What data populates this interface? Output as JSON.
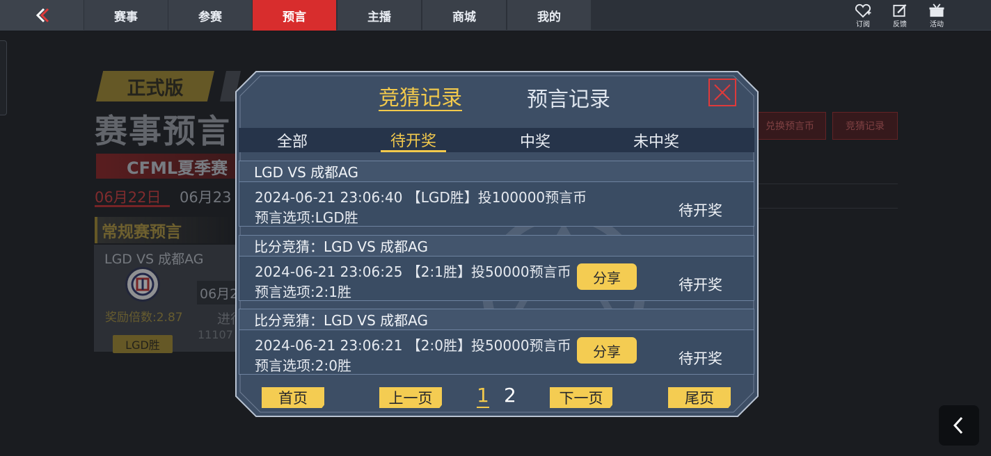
{
  "nav": {
    "tabs": [
      {
        "label": "赛事"
      },
      {
        "label": "参赛"
      },
      {
        "label": "预言"
      },
      {
        "label": "主播"
      },
      {
        "label": "商城"
      },
      {
        "label": "我的"
      }
    ],
    "active_index": 2,
    "icons": [
      {
        "name": "subscribe-icon",
        "label": "订阅"
      },
      {
        "name": "feedback-icon",
        "label": "反馈"
      },
      {
        "name": "event-icon",
        "label": "活动"
      }
    ]
  },
  "background": {
    "version_badge": "正式版",
    "title": "赛事预言",
    "season": "CFML夏季赛",
    "date_active": "06月22日",
    "date_next": "06月23",
    "section_title": "常规赛预言",
    "card_title": "LGD VS 成都AG",
    "card_odds": "奖励倍数:2.87",
    "card_pick": "LGD胜",
    "card_date": "06月2",
    "card_status": "进行",
    "card_number": "11107",
    "exchange_button": "兑换预言币",
    "records_button": "竞猜记录"
  },
  "modal": {
    "tabs": [
      {
        "label": "竞猜记录"
      },
      {
        "label": "预言记录"
      }
    ],
    "active_tab": 0,
    "filters": [
      {
        "label": "全部"
      },
      {
        "label": "待开奖"
      },
      {
        "label": "中奖"
      },
      {
        "label": "未中奖"
      }
    ],
    "active_filter": 1,
    "records": [
      {
        "title": "LGD VS 成都AG",
        "line1": "2024-06-21 23:06:40 【LGD胜】投100000预言币",
        "line2": "预言选项:LGD胜",
        "status": "待开奖",
        "share": null
      },
      {
        "title": "比分竞猜：LGD VS 成都AG",
        "line1": "2024-06-21 23:06:25 【2:1胜】投50000预言币",
        "line2": "预言选项:2:1胜",
        "status": "待开奖",
        "share": "分享"
      },
      {
        "title": "比分竞猜：LGD VS 成都AG",
        "line1": "2024-06-21 23:06:21 【2:0胜】投50000预言币",
        "line2": "预言选项:2:0胜",
        "status": "待开奖",
        "share": "分享"
      }
    ],
    "pagination": {
      "first": "首页",
      "prev": "上一页",
      "pages": [
        "1",
        "2"
      ],
      "current_page": "1",
      "next": "下一页",
      "last": "尾页"
    }
  },
  "colors": {
    "accent_yellow": "#f2c94c",
    "active_red": "#d82d2d",
    "modal_bg": "#3d4e65"
  }
}
